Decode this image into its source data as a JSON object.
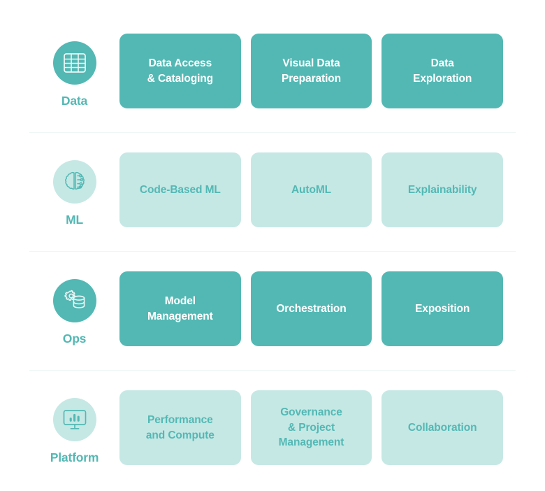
{
  "colors": {
    "solid_teal": "#53B8B4",
    "light_mint": "#C5E8E5",
    "text_on_solid": "#FFFFFF",
    "text_on_light": "#53B8B4",
    "divider": "#EEF6F6",
    "page_background": "#FFFFFF"
  },
  "rows": [
    {
      "category": {
        "label": "Data",
        "icon": "table-grid-icon",
        "style": "solid"
      },
      "cards": [
        {
          "label": "Data Access\n& Cataloging",
          "style": "solid"
        },
        {
          "label": "Visual Data\nPreparation",
          "style": "solid"
        },
        {
          "label": "Data\nExploration",
          "style": "solid"
        }
      ]
    },
    {
      "category": {
        "label": "ML",
        "icon": "brain-circuit-icon",
        "style": "light"
      },
      "cards": [
        {
          "label": "Code-Based ML",
          "style": "light"
        },
        {
          "label": "AutoML",
          "style": "light"
        },
        {
          "label": "Explainability",
          "style": "light"
        }
      ]
    },
    {
      "category": {
        "label": "Ops",
        "icon": "gear-database-icon",
        "style": "solid"
      },
      "cards": [
        {
          "label": "Model\nManagement",
          "style": "solid"
        },
        {
          "label": "Orchestration",
          "style": "solid"
        },
        {
          "label": "Exposition",
          "style": "solid"
        }
      ]
    },
    {
      "category": {
        "label": "Platform",
        "icon": "monitor-barchart-icon",
        "style": "light"
      },
      "cards": [
        {
          "label": "Performance\nand Compute",
          "style": "light"
        },
        {
          "label": "Governance\n& Project\nManagement",
          "style": "light"
        },
        {
          "label": "Collaboration",
          "style": "light"
        }
      ]
    }
  ]
}
